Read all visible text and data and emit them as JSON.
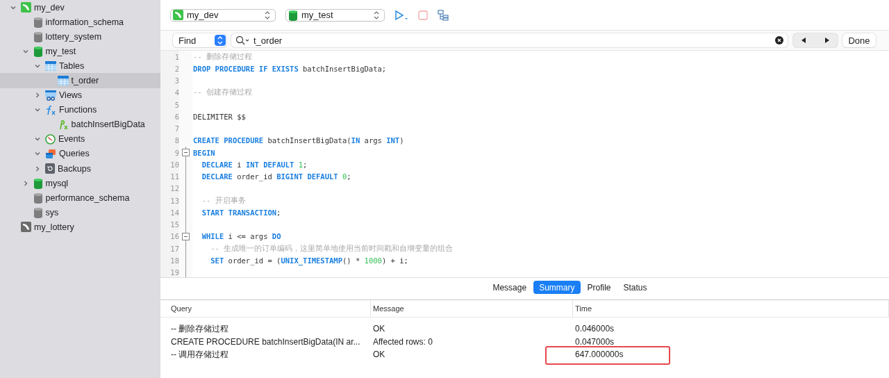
{
  "sidebar": {
    "items": [
      {
        "label": "my_dev",
        "kind": "connection",
        "active": true,
        "expanded": true,
        "selected": false,
        "children": [
          {
            "label": "information_schema",
            "kind": "database",
            "open": false,
            "selected": false
          },
          {
            "label": "lottery_system",
            "kind": "database",
            "open": false,
            "selected": false
          },
          {
            "label": "my_test",
            "kind": "database",
            "open": true,
            "expanded": true,
            "selected": false,
            "children": [
              {
                "label": "Tables",
                "kind": "tables",
                "expanded": true,
                "selected": false,
                "children": [
                  {
                    "label": "t_order",
                    "kind": "table",
                    "selected": true
                  }
                ]
              },
              {
                "label": "Views",
                "kind": "views",
                "expanded": false,
                "selected": false
              },
              {
                "label": "Functions",
                "kind": "functions",
                "expanded": true,
                "selected": false,
                "children": [
                  {
                    "label": "batchInsertBigData",
                    "kind": "procedure",
                    "selected": false
                  }
                ]
              },
              {
                "label": "Events",
                "kind": "events",
                "expanded": true,
                "selected": false
              },
              {
                "label": "Queries",
                "kind": "queries",
                "expanded": true,
                "selected": false
              },
              {
                "label": "Backups",
                "kind": "backups",
                "expanded": false,
                "selected": false
              }
            ]
          },
          {
            "label": "mysql",
            "kind": "database",
            "open": true,
            "expanded": false,
            "selected": false
          },
          {
            "label": "performance_schema",
            "kind": "database",
            "open": false,
            "selected": false
          },
          {
            "label": "sys",
            "kind": "database",
            "open": false,
            "selected": false
          }
        ]
      },
      {
        "label": "my_lottery",
        "kind": "connection",
        "active": false,
        "selected": false
      }
    ]
  },
  "toolbar": {
    "connection": "my_dev",
    "database": "my_test"
  },
  "find_bar": {
    "mode": "Find",
    "value": "t_order",
    "done": "Done"
  },
  "editor": {
    "lines": [
      {
        "number": "1",
        "tokens": [
          {
            "kind": "comment",
            "text": "-- 删除存储过程"
          }
        ]
      },
      {
        "number": "2",
        "tokens": [
          {
            "kind": "keyword",
            "text": "DROP PROCEDURE IF EXISTS"
          },
          {
            "kind": "plain",
            "text": " batchInsertBigData;"
          }
        ]
      },
      {
        "number": "3"
      },
      {
        "number": "4",
        "tokens": [
          {
            "kind": "comment",
            "text": "-- 创建存储过程"
          }
        ]
      },
      {
        "number": "5"
      },
      {
        "number": "6",
        "tokens": [
          {
            "kind": "plain",
            "text": "DELIMITER $$"
          }
        ]
      },
      {
        "number": "7"
      },
      {
        "number": "8",
        "tokens": [
          {
            "kind": "keyword",
            "text": "CREATE PROCEDURE"
          },
          {
            "kind": "plain",
            "text": " batchInsertBigData("
          },
          {
            "kind": "keyword",
            "text": "IN"
          },
          {
            "kind": "plain",
            "text": " args "
          },
          {
            "kind": "keyword",
            "text": "INT"
          },
          {
            "kind": "plain",
            "text": ")"
          }
        ]
      },
      {
        "number": "9",
        "fold": true,
        "tokens": [
          {
            "kind": "keyword",
            "text": "BEGIN"
          }
        ]
      },
      {
        "number": "10",
        "tokens": [
          {
            "kind": "keyword",
            "text": "  DECLARE"
          },
          {
            "kind": "plain",
            "text": " i "
          },
          {
            "kind": "keyword",
            "text": "INT DEFAULT"
          },
          {
            "kind": "number",
            "text": " 1"
          },
          {
            "kind": "plain",
            "text": ";"
          }
        ]
      },
      {
        "number": "11",
        "tokens": [
          {
            "kind": "keyword",
            "text": "  DECLARE"
          },
          {
            "kind": "plain",
            "text": " order_id "
          },
          {
            "kind": "keyword",
            "text": "BIGINT DEFAULT"
          },
          {
            "kind": "number",
            "text": " 0"
          },
          {
            "kind": "plain",
            "text": ";"
          }
        ]
      },
      {
        "number": "12"
      },
      {
        "number": "13",
        "tokens": [
          {
            "kind": "comment",
            "text": "  -- 开启事务"
          }
        ]
      },
      {
        "number": "14",
        "tokens": [
          {
            "kind": "keyword",
            "text": "  START TRANSACTION"
          },
          {
            "kind": "plain",
            "text": ";"
          }
        ]
      },
      {
        "number": "15"
      },
      {
        "number": "16",
        "fold": true,
        "tokens": [
          {
            "kind": "keyword",
            "text": "  WHILE"
          },
          {
            "kind": "plain",
            "text": " i <= args "
          },
          {
            "kind": "keyword",
            "text": "DO"
          }
        ]
      },
      {
        "number": "17",
        "tokens": [
          {
            "kind": "comment",
            "text": "    -- 生成唯一的订单编码，这里简单地使用当前时间戳和自增变量的组合"
          }
        ]
      },
      {
        "number": "18",
        "tokens": [
          {
            "kind": "keyword",
            "text": "    SET"
          },
          {
            "kind": "plain",
            "text": " order_id = ("
          },
          {
            "kind": "keyword",
            "text": "UNIX_TIMESTAMP"
          },
          {
            "kind": "plain",
            "text": "() * "
          },
          {
            "kind": "number",
            "text": "1000"
          },
          {
            "kind": "plain",
            "text": ") + i;"
          }
        ]
      },
      {
        "number": "19"
      }
    ]
  },
  "results": {
    "tabs": [
      {
        "label": "Message",
        "selected": false
      },
      {
        "label": "Summary",
        "selected": true
      },
      {
        "label": "Profile",
        "selected": false
      },
      {
        "label": "Status",
        "selected": false
      }
    ],
    "columns": [
      "Query",
      "Message",
      "Time"
    ],
    "rows": [
      {
        "query": "-- 删除存储过程",
        "message": "OK",
        "time": "0.046000s",
        "highlighted": false
      },
      {
        "query": "CREATE PROCEDURE batchInsertBigData(IN ar...",
        "message": "Affected rows: 0",
        "time": "0.047000s",
        "highlighted": false
      },
      {
        "query": "-- 调用存储过程",
        "message": "OK",
        "time": "647.000000s",
        "highlighted": true
      }
    ]
  }
}
